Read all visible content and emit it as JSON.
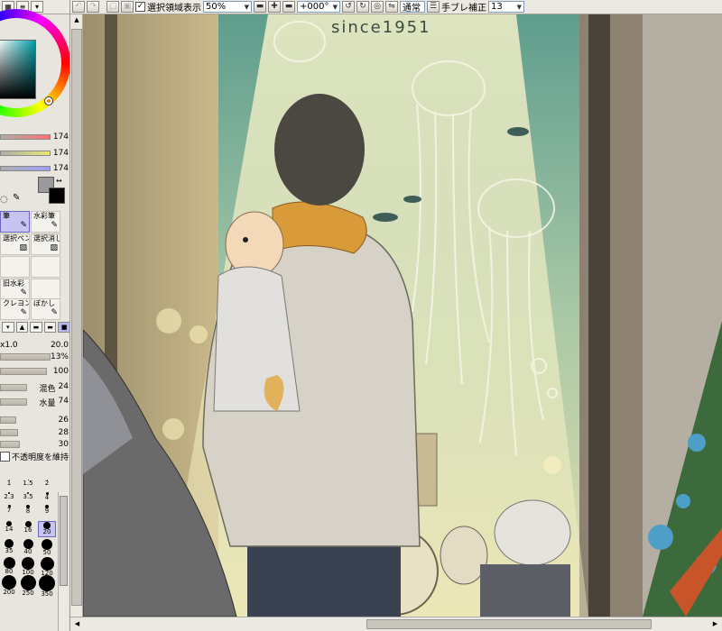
{
  "toolbar": {
    "show_selection_label": "選択領域表示",
    "zoom_value": "50%",
    "rotation_value": "+000°",
    "blend_mode": "通常",
    "stabilizer_label": "手ブレ補正",
    "stabilizer_value": "13"
  },
  "color_sliders": {
    "r": "174",
    "g": "174",
    "b": "174"
  },
  "tools": [
    {
      "label": "筆"
    },
    {
      "label": "水彩筆"
    },
    {
      "label": "選択ペン"
    },
    {
      "label": "選択消し"
    },
    {
      "label": "旧水彩"
    },
    {
      "label": "クレヨン"
    },
    {
      "label": "ぼかし"
    }
  ],
  "brush_params": {
    "size_multiplier": "x1.0",
    "size_value": "20.0",
    "min_size": "13%",
    "density": "100",
    "blend_label": "混色",
    "blend_value": "24",
    "water_label": "水量",
    "water_value": "74",
    "color_extend": "26",
    "persistence": "28",
    "blur": "30"
  },
  "keep_opacity_label": "不透明度を維持",
  "brush_sizes": [
    {
      "label": "1"
    },
    {
      "label": "1.5"
    },
    {
      "label": "2"
    },
    {
      "label": "2.3"
    },
    {
      "label": "3.5"
    },
    {
      "label": "4"
    },
    {
      "label": "7"
    },
    {
      "label": "8"
    },
    {
      "label": "9"
    },
    {
      "label": "14"
    },
    {
      "label": "16"
    },
    {
      "label": "20"
    },
    {
      "label": "35"
    },
    {
      "label": "40"
    },
    {
      "label": "50"
    },
    {
      "label": "80"
    },
    {
      "label": "100"
    },
    {
      "label": "120"
    },
    {
      "label": "200"
    },
    {
      "label": "250"
    },
    {
      "label": "350"
    }
  ],
  "artwork": {
    "sign_text": "since1951"
  },
  "colors": {
    "selection_highlight": "#c7c4f2",
    "foreground": "#9a9a9a",
    "background": "#000000"
  }
}
